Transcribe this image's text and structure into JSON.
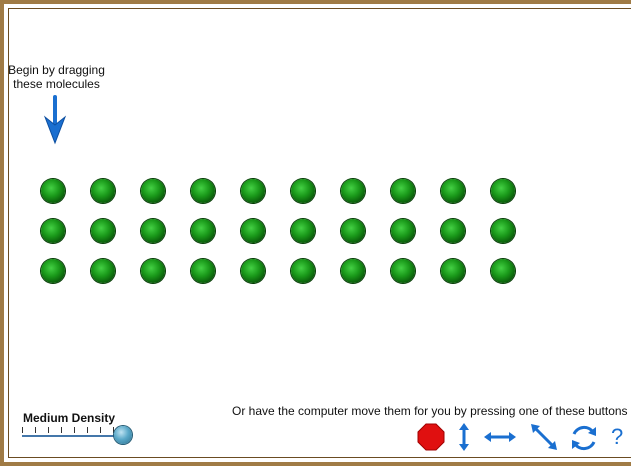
{
  "instructions": {
    "drag_hint": "Begin by dragging these molecules",
    "auto_hint": "Or have the computer move them for you by pressing one of these buttons"
  },
  "density": {
    "label": "Medium Density",
    "level": 1.0
  },
  "molecules": {
    "rows": 3,
    "cols": 10,
    "color": "#1a9a1a"
  },
  "buttons": [
    {
      "name": "stop-button",
      "icon": "stop-octagon-icon",
      "color": "#e01010"
    },
    {
      "name": "vertical-motion-button",
      "icon": "vertical-double-arrow-icon",
      "color": "#1a6fd0"
    },
    {
      "name": "horizontal-motion-button",
      "icon": "horizontal-double-arrow-icon",
      "color": "#1a6fd0"
    },
    {
      "name": "diagonal-motion-button",
      "icon": "diagonal-double-arrow-icon",
      "color": "#1a6fd0"
    },
    {
      "name": "rotate-motion-button",
      "icon": "circular-arrows-icon",
      "color": "#1a6fd0"
    },
    {
      "name": "help-button",
      "icon": "question-mark",
      "label": "?"
    }
  ],
  "colors": {
    "frame": "#a07b45",
    "arrow": "#1a6fd0"
  }
}
